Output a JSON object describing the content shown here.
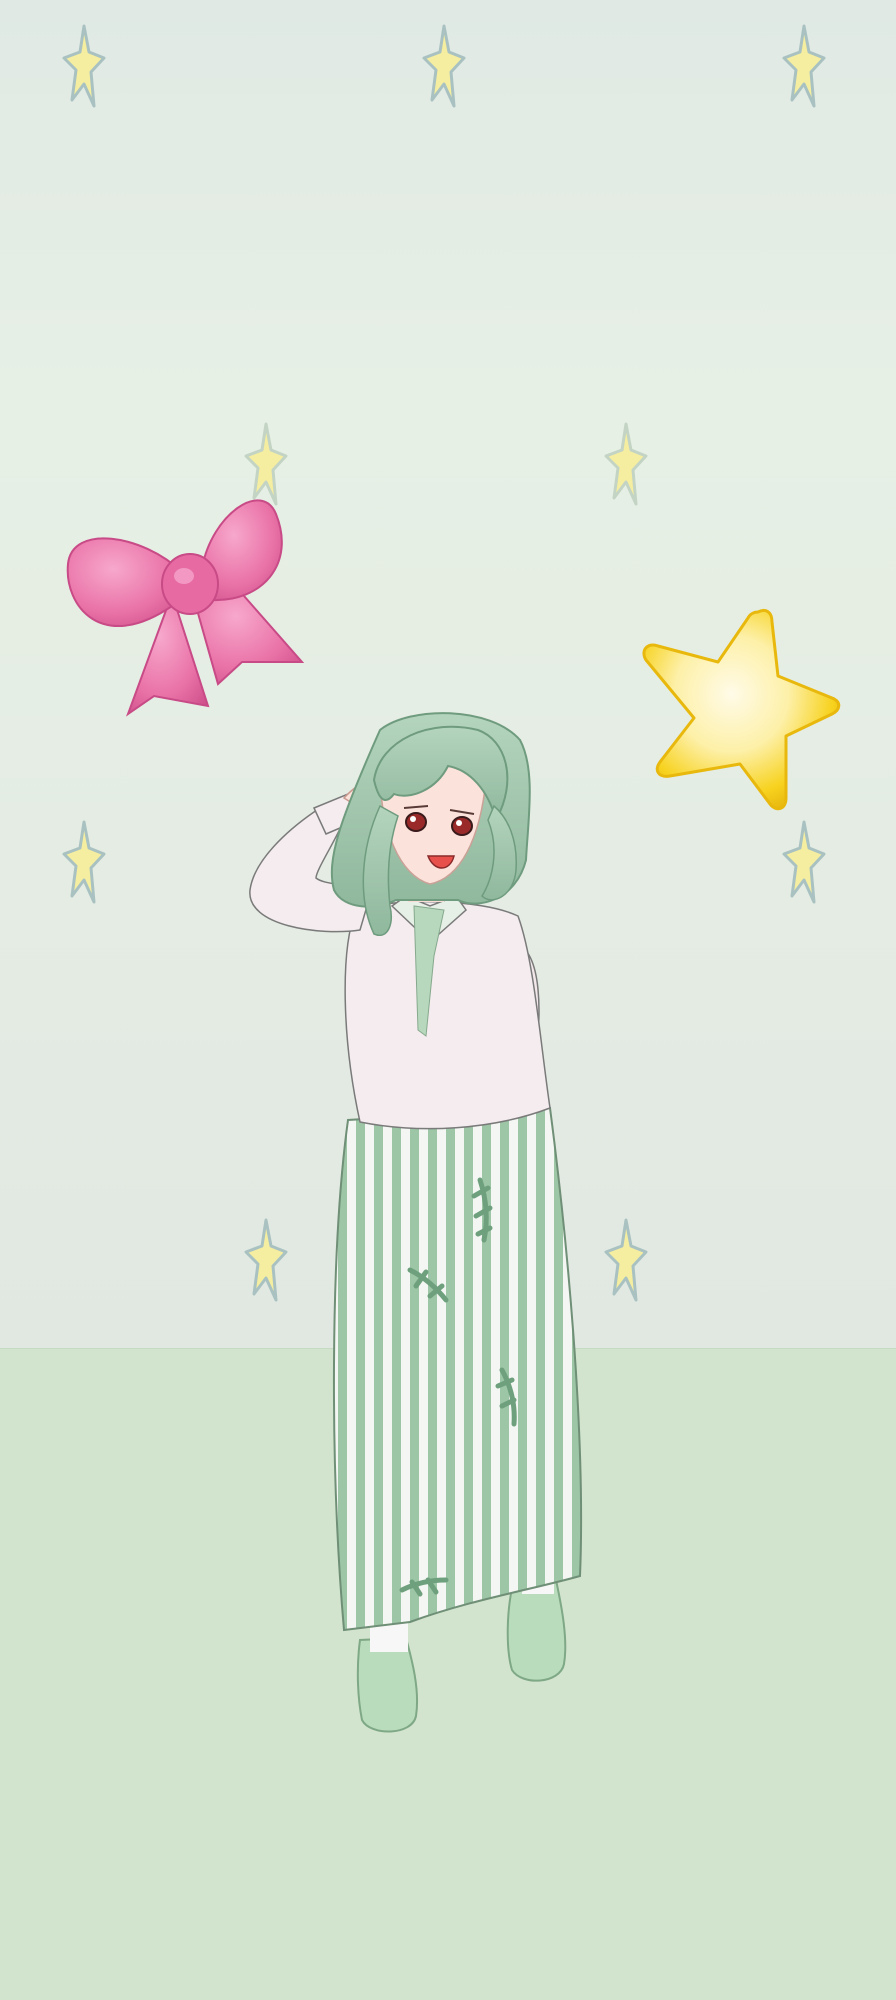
{
  "scene": {
    "description_free": true,
    "colors": {
      "wall_top": "#e2ebe6",
      "wall_mid": "#e7efe4",
      "wall_bottom": "#e1e8e2",
      "floor": "#d2e4cd",
      "small_star_fill": "#f5eea0",
      "small_star_outline": "#a9c2c1",
      "bow": "#ee7fb0",
      "bow_shadow": "#d1558f",
      "big_star": "#f7d21e",
      "big_star_glow": "#fdf6cf",
      "hair": "#a3c8ae",
      "skin": "#fbe3dc",
      "shirt": "#f4ecee",
      "skirt_stripe": "#9cc6a6",
      "shoes": "#b9dcbc"
    },
    "icons": {
      "small_star": "star-icon",
      "bow": "bow-icon",
      "big_star": "star-icon",
      "avatar": "character-figure"
    }
  }
}
